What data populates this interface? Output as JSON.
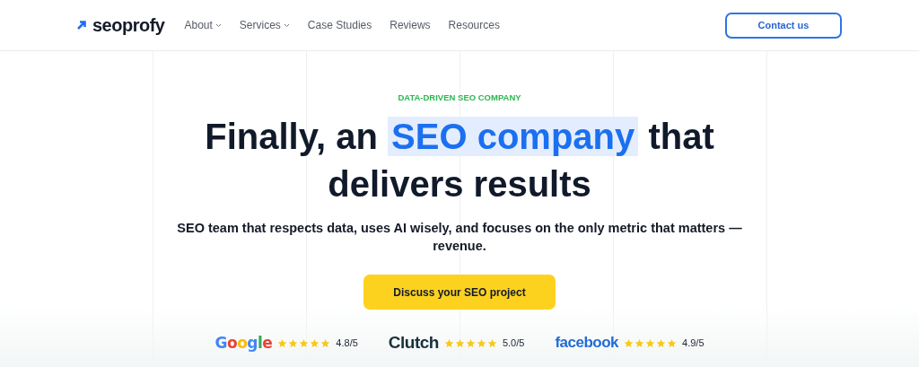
{
  "header": {
    "logo": "seoprofy",
    "nav": [
      {
        "label": "About",
        "dropdown": true
      },
      {
        "label": "Services",
        "dropdown": true
      },
      {
        "label": "Case Studies",
        "dropdown": false
      },
      {
        "label": "Reviews",
        "dropdown": false
      },
      {
        "label": "Resources",
        "dropdown": false
      }
    ],
    "cta": "Contact us"
  },
  "hero": {
    "eyebrow": "DATA-DRIVEN SEO COMPANY",
    "headline": {
      "before": "Finally, an",
      "highlight": "SEO company",
      "after": "that delivers results"
    },
    "subtitle": "SEO team that respects data, uses AI wisely, and focuses on the only metric that matters — revenue.",
    "button": "Discuss your SEO project"
  },
  "ratings": [
    {
      "kind": "google",
      "brand": "Google",
      "stars": 5,
      "score": "4.8/5"
    },
    {
      "kind": "clutch",
      "brand": "Clutch",
      "stars": 5,
      "score": "5.0/5"
    },
    {
      "kind": "facebook",
      "brand": "facebook",
      "stars": 5,
      "score": "4.9/5"
    }
  ]
}
